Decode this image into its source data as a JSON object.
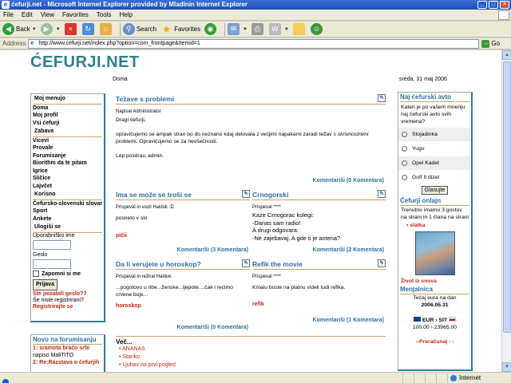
{
  "window": {
    "title": "ćefurji.net - Microsoft Internet Explorer provided by Mladinin Internet Explorer"
  },
  "menu": [
    "File",
    "Edit",
    "View",
    "Favorites",
    "Tools",
    "Help"
  ],
  "toolbar": {
    "back": "Back",
    "search": "Search",
    "favorites": "Favorites"
  },
  "address": {
    "label": "Address",
    "url": "http://www.cefurji.net/index.php?option=com_frontpage&Itemid=1",
    "go": "Go"
  },
  "status": {
    "zone": "Internet"
  },
  "site": {
    "logo": "ĆEFURJI.NET",
    "crumb": "Doma",
    "date": "sreda, 31 maj 2006"
  },
  "left": {
    "moj_menujo_title": "Moj menujo",
    "moj_menujo": [
      "Doma",
      "Moj profil",
      "Vsi ćefurji"
    ],
    "zabava_title": "Zabava",
    "zabava": [
      "Vicevi",
      "Provale",
      "Forumisanje",
      "Biorithm da te pitam",
      "Igrice",
      "Sličice",
      "Lajvčet"
    ],
    "korisno_title": "Korisno",
    "korisno": [
      "Ćefursko-slovenski slovar",
      "Sport",
      "Ankete"
    ],
    "login_title": "Ulogiši se",
    "user_label": "Uporabniško ime",
    "pass_label": "Geslo",
    "remember": "Zapomni si me",
    "login_btn": "Prijava",
    "forgot": "Ste pozabili geslo??",
    "notreg": "Še niste registrirani?",
    "register": "Registrirajte se",
    "forum_title": "Novo na forumisanju",
    "forum": [
      {
        "n": "1:",
        "t": "sramota braćo srbi",
        "by": "napiso MaliTITO"
      },
      {
        "n": "2:",
        "t": "Re:Razstava o ćefurjih",
        "by": ""
      }
    ]
  },
  "center": {
    "main": {
      "title": "Težave s problemi",
      "author": "Napisal Administrator",
      "greeting": "Dragi ćefurji,",
      "body1": "opravičujemo se ampak stran bo do neznano kdaj delovala z večjimi napakami zaradi težav s",
      "body1_em": "skrivnostnimi",
      "body2": "problemi. Opravičujemo se za nevšečnosti.",
      "signoff": "Lep pozdrav, admin.",
      "more": "Komentariši (0 Komentara)"
    },
    "a2": {
      "title": "Ima se može se troši se",
      "meta": "Prispeval in vozil Halduk :D",
      "body": "posneto v slo",
      "tag": "pičii",
      "more": "Komentariši (3 Komentara)"
    },
    "a3": {
      "title": "Crnogorski",
      "meta": "Prispeval ****",
      "lines": [
        "Kaze Crnogorac kolegi:",
        "-Danas sam radio!",
        "A drugi odgovara:",
        "-Ne zajebavaj. A gde ti je antena?"
      ],
      "more": "Komentariši (2 Komentara)"
    },
    "a4": {
      "title": "Da li verujete u horoskop?",
      "meta": "Prispeval in režiral Halduk",
      "body": "...pogotovo u ribe...ženske...ljepote....čak i recimo crvene boje...",
      "tag": "horoskop",
      "more": "Komentariši (0 Komentara)"
    },
    "a5": {
      "title": "Refik the movie",
      "meta": "Prispeval ****",
      "body": "Kmalu boste na platnu videli tudi refika.",
      "tag": "refik",
      "more": "Komentariši (1 Komentara)"
    },
    "vec": {
      "title": "Več...",
      "items": [
        "ANANAS",
        "Stanko",
        "Ljubav na prvi pogled"
      ]
    }
  },
  "right": {
    "poll_title": "Naj ćefurski avto",
    "poll_q": "Kateri je po vašem mnenju naj ćefurski avto svih vremena?",
    "poll_opts": [
      "Stojadinka",
      "Yugo",
      "Opel Kadet",
      "Golf II dizel"
    ],
    "poll_btn": "Glasujte",
    "online_title": "Ćefurji onlajn",
    "online_text": "Trenutno imamo 3 gostov na strani in 1 člana na strani",
    "online_user": "slatka",
    "photo_caption": "Život iz snova",
    "mena_title": "Menjalnica",
    "mena_text": "Tečaj eura na dan",
    "mena_date": "2006.05.31",
    "mena_pair": "EUR › SIT",
    "mena_vals": "100.00 › 23965.00",
    "mena_more": "--Preračunaj - -"
  }
}
